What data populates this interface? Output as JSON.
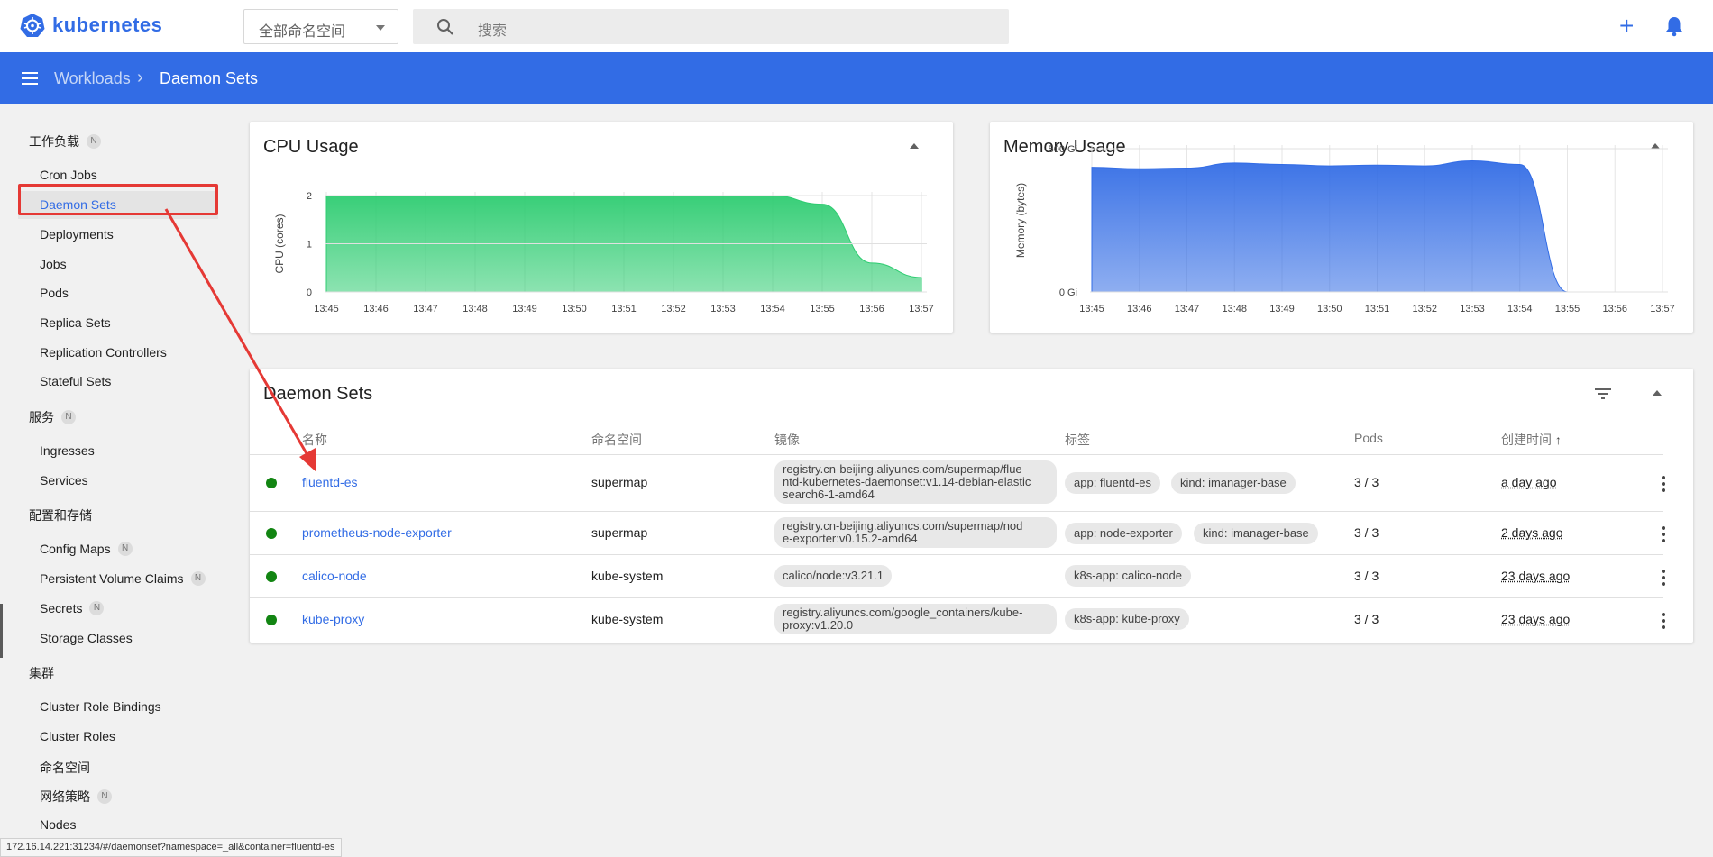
{
  "app": {
    "name": "kubernetes"
  },
  "topbar": {
    "namespace_value": "全部命名空间",
    "search_placeholder": "搜索"
  },
  "breadcrumb": {
    "parent": "Workloads",
    "current": "Daemon Sets"
  },
  "sidebar": {
    "sections": [
      {
        "label": "工作负载",
        "badge": "N",
        "items": [
          "Cron Jobs",
          "Daemon Sets",
          "Deployments",
          "Jobs",
          "Pods",
          "Replica Sets",
          "Replication Controllers",
          "Stateful Sets"
        ]
      },
      {
        "label": "服务",
        "badge": "N",
        "items": [
          "Ingresses",
          "Services"
        ]
      },
      {
        "label": "配置和存储",
        "items": [
          "Config Maps",
          "Persistent Volume Claims",
          "Secrets",
          "Storage Classes"
        ],
        "item_badges": {
          "Config Maps": "N",
          "Persistent Volume Claims": "N",
          "Secrets": "N"
        }
      },
      {
        "label": "集群",
        "items": [
          "Cluster Role Bindings",
          "Cluster Roles",
          "命名空间",
          "网络策略",
          "Nodes"
        ],
        "item_badges": {
          "网络策略": "N"
        }
      }
    ],
    "active_item": "Daemon Sets",
    "badge": "N"
  },
  "cpu_card": {
    "title": "CPU Usage"
  },
  "memory_card": {
    "title": "Memory Usage"
  },
  "chart_data": [
    {
      "type": "area",
      "title": "CPU Usage",
      "ylabel": "CPU (cores)",
      "xlabel": "",
      "x": [
        "13:45",
        "13:46",
        "13:47",
        "13:48",
        "13:49",
        "13:50",
        "13:51",
        "13:52",
        "13:53",
        "13:54",
        "13:55",
        "13:56",
        "13:57"
      ],
      "yticks": [
        "0",
        "1",
        "2"
      ],
      "ylim": [
        0,
        2
      ],
      "series": [
        {
          "values": [
            2.0,
            1.98,
            1.99,
            2.0,
            1.99,
            1.99,
            1.99,
            1.99,
            1.99,
            2.0,
            1.82,
            0.6,
            0.3
          ]
        }
      ],
      "color": "#2ecc71",
      "grid": true
    },
    {
      "type": "area",
      "title": "Memory Usage",
      "ylabel": "Memory (bytes)",
      "xlabel": "",
      "x": [
        "13:45",
        "13:46",
        "13:47",
        "13:48",
        "13:49",
        "13:50",
        "13:51",
        "13:52",
        "13:53",
        "13:54",
        "13:55",
        "13:56",
        "13:57"
      ],
      "yticks": [
        "0 Gi",
        "500 Gi"
      ],
      "ylim": [
        0,
        1000
      ],
      "series": [
        {
          "values": [
            870,
            860,
            865,
            900,
            890,
            880,
            885,
            880,
            915,
            890,
            0,
            0,
            0
          ]
        }
      ],
      "color": "#326ce5",
      "grid": true
    }
  ],
  "daemonsets": {
    "title": "Daemon Sets",
    "columns": [
      "名称",
      "命名空间",
      "镜像",
      "标签",
      "Pods",
      "创建时间"
    ],
    "rows": [
      {
        "name": "fluentd-es",
        "namespace": "supermap",
        "image": "registry.cn-beijing.aliyuncs.com/supermap/fluentd-kubernetes-daemonset:v1.14-debian-elasticsearch6-1-amd64",
        "image_lines": [
          "registry.cn-beijing.aliyuncs.com/supermap/flue",
          "ntd-kubernetes-daemonset:v1.14-debian-elastic",
          "search6-1-amd64"
        ],
        "labels": [
          "app: fluentd-es",
          "kind: imanager-base"
        ],
        "pods": "3 / 3",
        "created": "a day ago"
      },
      {
        "name": "prometheus-node-exporter",
        "namespace": "supermap",
        "image": "registry.cn-beijing.aliyuncs.com/supermap/node-exporter:v0.15.2-amd64",
        "image_lines": [
          "registry.cn-beijing.aliyuncs.com/supermap/nod",
          "e-exporter:v0.15.2-amd64"
        ],
        "labels": [
          "app: node-exporter",
          "kind: imanager-base"
        ],
        "pods": "3 / 3",
        "created": "2 days ago"
      },
      {
        "name": "calico-node",
        "namespace": "kube-system",
        "image": "calico/node:v3.21.1",
        "image_lines": [
          "calico/node:v3.21.1"
        ],
        "labels": [
          "k8s-app: calico-node"
        ],
        "pods": "3 / 3",
        "created": "23 days ago"
      },
      {
        "name": "kube-proxy",
        "namespace": "kube-system",
        "image": "registry.aliyuncs.com/google_containers/kube-proxy:v1.20.0",
        "image_lines": [
          "registry.aliyuncs.com/google_containers/kube-",
          "proxy:v1.20.0"
        ],
        "labels": [
          "k8s-app: kube-proxy"
        ],
        "pods": "3 / 3",
        "created": "23 days ago"
      }
    ]
  },
  "status_bar": {
    "url": "172.16.14.221:31234/#/daemonset?namespace=_all&container=fluentd-es"
  },
  "colors": {
    "primary": "#326ce5",
    "success": "#128512",
    "annotation": "#e53935"
  }
}
